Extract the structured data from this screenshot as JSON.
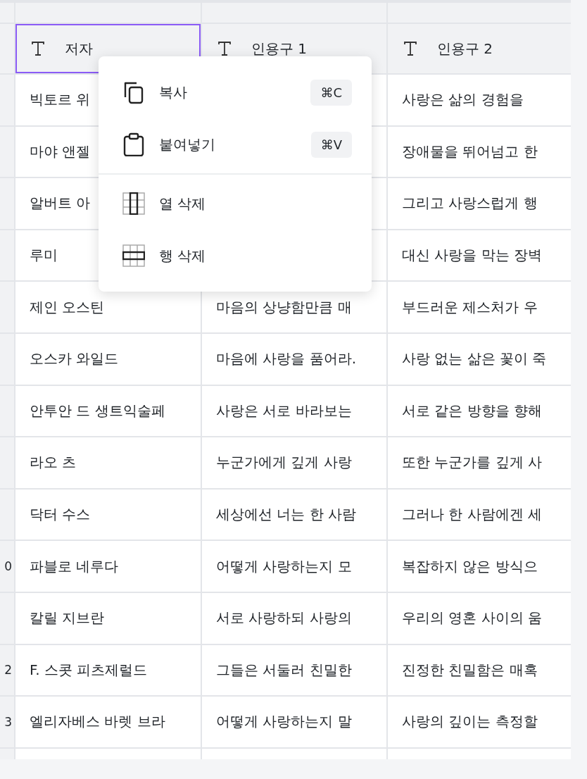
{
  "table": {
    "columns": [
      {
        "label": "저자",
        "selected": true
      },
      {
        "label": "인용구 1",
        "selected": false
      },
      {
        "label": "인용구 2",
        "selected": false
      }
    ],
    "rows": [
      {
        "cells": [
          "빅토르 위",
          "",
          "사랑은 삶의 경험을"
        ]
      },
      {
        "cells": [
          "마야 앤젤",
          "",
          "장애물을 뛰어넘고 한"
        ]
      },
      {
        "cells": [
          "알버트 아",
          "",
          "그리고 사랑스럽게 행"
        ]
      },
      {
        "cells": [
          "루미",
          "",
          "대신 사랑을 막는 장벽"
        ]
      },
      {
        "cells": [
          "제인 오스틴",
          "마음의 상냥함만큼 매",
          "부드러운 제스처가 우"
        ]
      },
      {
        "cells": [
          "오스카 와일드",
          "마음에 사랑을 품어라.",
          "사랑 없는 삶은 꽃이 죽"
        ]
      },
      {
        "cells": [
          "안투안 드 생트익술페",
          "사랑은 서로 바라보는",
          "서로 같은 방향을 향해"
        ]
      },
      {
        "cells": [
          "라오 츠",
          "누군가에게 깊게 사랑",
          "또한 누군가를 깊게 사"
        ]
      },
      {
        "cells": [
          "닥터 수스",
          "세상에선 너는 한 사람",
          "그러나 한 사람에겐 세"
        ]
      },
      {
        "row_number": "0",
        "cells": [
          "파블로 네루다",
          "어떻게 사랑하는지 모",
          "복잡하지 않은 방식으"
        ]
      },
      {
        "cells": [
          "칼릴 지브란",
          "서로 사랑하되 사랑의",
          "우리의 영혼 사이의 움"
        ]
      },
      {
        "row_number": "2",
        "cells": [
          "F. 스콧 피츠제럴드",
          "그들은 서둘러 친밀한",
          "진정한 친밀함은 매혹"
        ]
      },
      {
        "row_number": "3",
        "cells": [
          "엘리자베스 바렛 브라",
          "어떻게 사랑하는지 말",
          "사랑의 깊이는 측정할"
        ]
      }
    ]
  },
  "context_menu": {
    "items": [
      {
        "kind": "copy",
        "label": "복사",
        "shortcut": "⌘C"
      },
      {
        "kind": "paste",
        "label": "붙여넣기",
        "shortcut": "⌘V"
      },
      {
        "kind": "divider"
      },
      {
        "kind": "delete-column",
        "label": "열 삭제"
      },
      {
        "kind": "delete-row",
        "label": "행 삭제"
      }
    ]
  }
}
